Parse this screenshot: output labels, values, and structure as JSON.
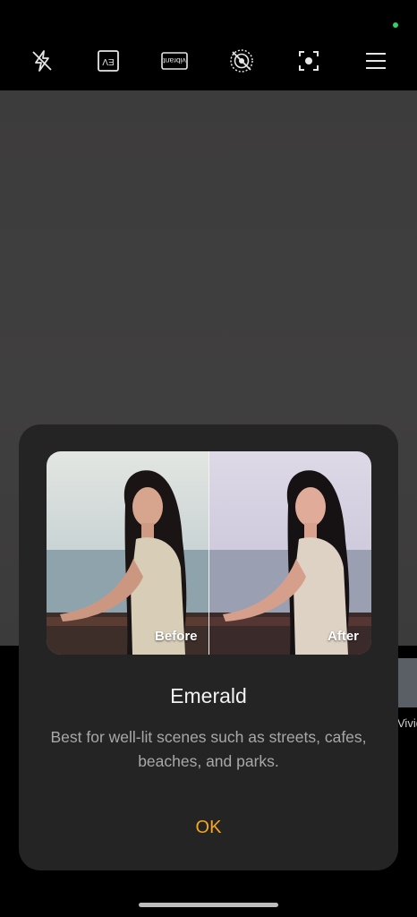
{
  "toolbar": {
    "items": [
      {
        "icon": "flash-off-icon"
      },
      {
        "icon": "ev-icon",
        "label": "EV"
      },
      {
        "icon": "vibrant-icon",
        "label": "vibrant"
      },
      {
        "icon": "live-photo-off-icon"
      },
      {
        "icon": "focus-icon"
      },
      {
        "icon": "menu-icon"
      }
    ]
  },
  "side_mode_label": "Vivid",
  "dialog": {
    "compare": {
      "before_label": "Before",
      "after_label": "After"
    },
    "title": "Emerald",
    "description": "Best for well-lit scenes such as streets, cafes, beaches, and parks.",
    "ok_label": "OK"
  },
  "colors": {
    "accent": "#f5a623",
    "dialog_background": "#242424",
    "status_dot": "#2fd36b"
  }
}
